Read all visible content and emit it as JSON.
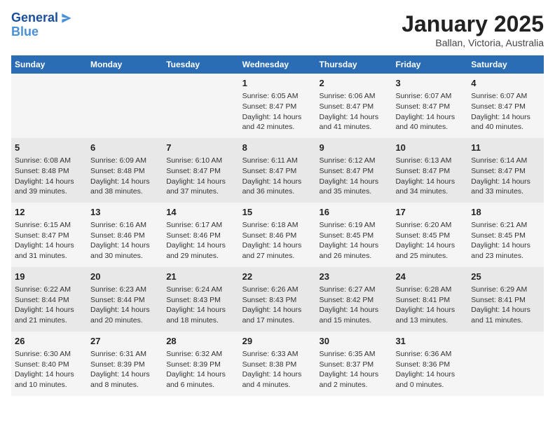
{
  "header": {
    "logo_line1": "General",
    "logo_line2": "Blue",
    "month_title": "January 2025",
    "location": "Ballan, Victoria, Australia"
  },
  "weekdays": [
    "Sunday",
    "Monday",
    "Tuesday",
    "Wednesday",
    "Thursday",
    "Friday",
    "Saturday"
  ],
  "weeks": [
    [
      {
        "day": "",
        "info": ""
      },
      {
        "day": "",
        "info": ""
      },
      {
        "day": "",
        "info": ""
      },
      {
        "day": "1",
        "info": "Sunrise: 6:05 AM\nSunset: 8:47 PM\nDaylight: 14 hours\nand 42 minutes."
      },
      {
        "day": "2",
        "info": "Sunrise: 6:06 AM\nSunset: 8:47 PM\nDaylight: 14 hours\nand 41 minutes."
      },
      {
        "day": "3",
        "info": "Sunrise: 6:07 AM\nSunset: 8:47 PM\nDaylight: 14 hours\nand 40 minutes."
      },
      {
        "day": "4",
        "info": "Sunrise: 6:07 AM\nSunset: 8:47 PM\nDaylight: 14 hours\nand 40 minutes."
      }
    ],
    [
      {
        "day": "5",
        "info": "Sunrise: 6:08 AM\nSunset: 8:48 PM\nDaylight: 14 hours\nand 39 minutes."
      },
      {
        "day": "6",
        "info": "Sunrise: 6:09 AM\nSunset: 8:48 PM\nDaylight: 14 hours\nand 38 minutes."
      },
      {
        "day": "7",
        "info": "Sunrise: 6:10 AM\nSunset: 8:47 PM\nDaylight: 14 hours\nand 37 minutes."
      },
      {
        "day": "8",
        "info": "Sunrise: 6:11 AM\nSunset: 8:47 PM\nDaylight: 14 hours\nand 36 minutes."
      },
      {
        "day": "9",
        "info": "Sunrise: 6:12 AM\nSunset: 8:47 PM\nDaylight: 14 hours\nand 35 minutes."
      },
      {
        "day": "10",
        "info": "Sunrise: 6:13 AM\nSunset: 8:47 PM\nDaylight: 14 hours\nand 34 minutes."
      },
      {
        "day": "11",
        "info": "Sunrise: 6:14 AM\nSunset: 8:47 PM\nDaylight: 14 hours\nand 33 minutes."
      }
    ],
    [
      {
        "day": "12",
        "info": "Sunrise: 6:15 AM\nSunset: 8:47 PM\nDaylight: 14 hours\nand 31 minutes."
      },
      {
        "day": "13",
        "info": "Sunrise: 6:16 AM\nSunset: 8:46 PM\nDaylight: 14 hours\nand 30 minutes."
      },
      {
        "day": "14",
        "info": "Sunrise: 6:17 AM\nSunset: 8:46 PM\nDaylight: 14 hours\nand 29 minutes."
      },
      {
        "day": "15",
        "info": "Sunrise: 6:18 AM\nSunset: 8:46 PM\nDaylight: 14 hours\nand 27 minutes."
      },
      {
        "day": "16",
        "info": "Sunrise: 6:19 AM\nSunset: 8:45 PM\nDaylight: 14 hours\nand 26 minutes."
      },
      {
        "day": "17",
        "info": "Sunrise: 6:20 AM\nSunset: 8:45 PM\nDaylight: 14 hours\nand 25 minutes."
      },
      {
        "day": "18",
        "info": "Sunrise: 6:21 AM\nSunset: 8:45 PM\nDaylight: 14 hours\nand 23 minutes."
      }
    ],
    [
      {
        "day": "19",
        "info": "Sunrise: 6:22 AM\nSunset: 8:44 PM\nDaylight: 14 hours\nand 21 minutes."
      },
      {
        "day": "20",
        "info": "Sunrise: 6:23 AM\nSunset: 8:44 PM\nDaylight: 14 hours\nand 20 minutes."
      },
      {
        "day": "21",
        "info": "Sunrise: 6:24 AM\nSunset: 8:43 PM\nDaylight: 14 hours\nand 18 minutes."
      },
      {
        "day": "22",
        "info": "Sunrise: 6:26 AM\nSunset: 8:43 PM\nDaylight: 14 hours\nand 17 minutes."
      },
      {
        "day": "23",
        "info": "Sunrise: 6:27 AM\nSunset: 8:42 PM\nDaylight: 14 hours\nand 15 minutes."
      },
      {
        "day": "24",
        "info": "Sunrise: 6:28 AM\nSunset: 8:41 PM\nDaylight: 14 hours\nand 13 minutes."
      },
      {
        "day": "25",
        "info": "Sunrise: 6:29 AM\nSunset: 8:41 PM\nDaylight: 14 hours\nand 11 minutes."
      }
    ],
    [
      {
        "day": "26",
        "info": "Sunrise: 6:30 AM\nSunset: 8:40 PM\nDaylight: 14 hours\nand 10 minutes."
      },
      {
        "day": "27",
        "info": "Sunrise: 6:31 AM\nSunset: 8:39 PM\nDaylight: 14 hours\nand 8 minutes."
      },
      {
        "day": "28",
        "info": "Sunrise: 6:32 AM\nSunset: 8:39 PM\nDaylight: 14 hours\nand 6 minutes."
      },
      {
        "day": "29",
        "info": "Sunrise: 6:33 AM\nSunset: 8:38 PM\nDaylight: 14 hours\nand 4 minutes."
      },
      {
        "day": "30",
        "info": "Sunrise: 6:35 AM\nSunset: 8:37 PM\nDaylight: 14 hours\nand 2 minutes."
      },
      {
        "day": "31",
        "info": "Sunrise: 6:36 AM\nSunset: 8:36 PM\nDaylight: 14 hours\nand 0 minutes."
      },
      {
        "day": "",
        "info": ""
      }
    ]
  ]
}
